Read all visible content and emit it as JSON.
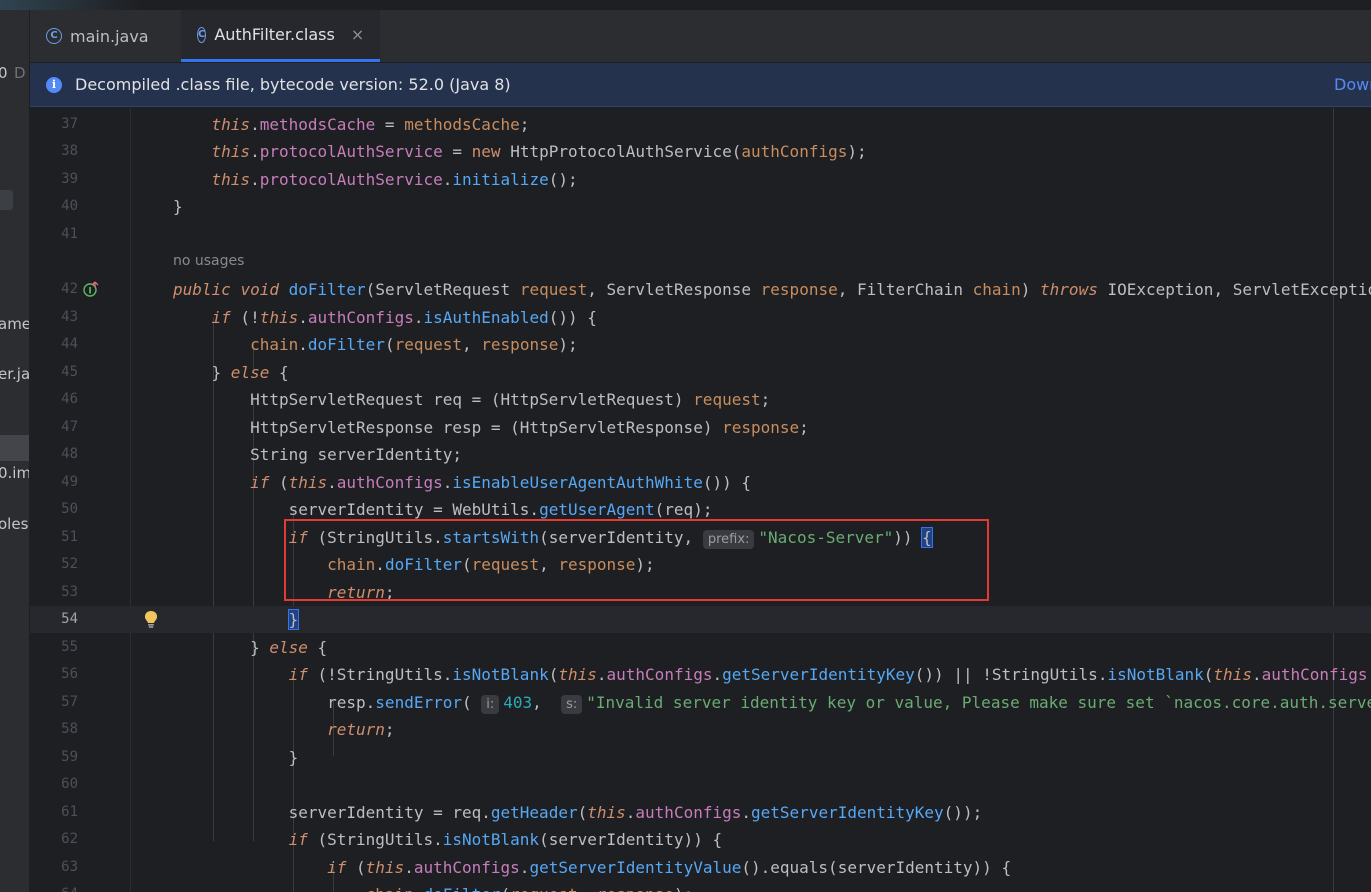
{
  "sidebar": {
    "fragments": [
      "0",
      "D",
      "ame",
      "er.ja",
      "0.im",
      "oles"
    ]
  },
  "tabs": [
    {
      "label": "main.java",
      "active": false,
      "icon": "class-c-icon"
    },
    {
      "label": "AuthFilter.class",
      "active": true,
      "icon": "class-c-icon",
      "close": "×"
    }
  ],
  "banner": {
    "text": "Decompiled .class file, bytecode version: 52.0 (Java 8)",
    "link": "Down",
    "icon": "info-icon"
  },
  "editor": {
    "usages_hint": "no usages",
    "hints": {
      "prefix": "prefix:",
      "i": "i:",
      "s": "s:"
    },
    "gutter_icons": {
      "line42": "overriding-method-icon",
      "line54": "lightbulb-icon"
    },
    "lines": {
      "l37": "37",
      "l38": "38",
      "l39": "39",
      "l40": "40",
      "l41": "41",
      "l42": "42",
      "l43": "43",
      "l44": "44",
      "l45": "45",
      "l46": "46",
      "l47": "47",
      "l48": "48",
      "l49": "49",
      "l50": "50",
      "l51": "51",
      "l52": "52",
      "l53": "53",
      "l54": "54",
      "l55": "55",
      "l56": "56",
      "l57": "57",
      "l58": "58",
      "l59": "59",
      "l60": "60",
      "l61": "61",
      "l62": "62",
      "l63": "63",
      "l64": "64"
    },
    "current_line": "54",
    "highlight_color": "#e53935"
  }
}
